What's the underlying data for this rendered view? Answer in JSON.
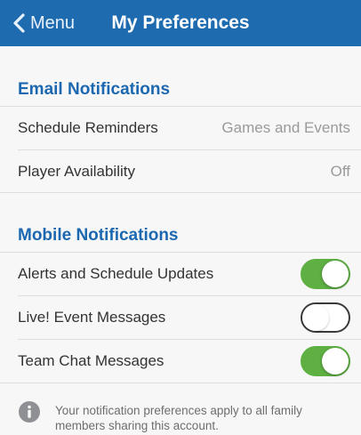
{
  "header": {
    "back_label": "Menu",
    "title": "My Preferences"
  },
  "email_notifications": {
    "header": "Email Notifications",
    "rows": [
      {
        "label": "Schedule Reminders",
        "value": "Games and Events"
      },
      {
        "label": "Player Availability",
        "value": "Off"
      }
    ]
  },
  "mobile_notifications": {
    "header": "Mobile Notifications",
    "rows": [
      {
        "label": "Alerts and Schedule Updates",
        "enabled": true
      },
      {
        "label": "Live! Event Messages",
        "enabled": false
      },
      {
        "label": "Team Chat Messages",
        "enabled": true
      }
    ]
  },
  "footer_note": "Your notification preferences apply to all family members sharing this account.",
  "icons": {
    "back": "chevron-left-icon",
    "info": "info-circle-icon"
  },
  "colors": {
    "navbar": "#1e6bb0",
    "section_header": "#1c68b0",
    "toggle_on": "#5eb043"
  }
}
